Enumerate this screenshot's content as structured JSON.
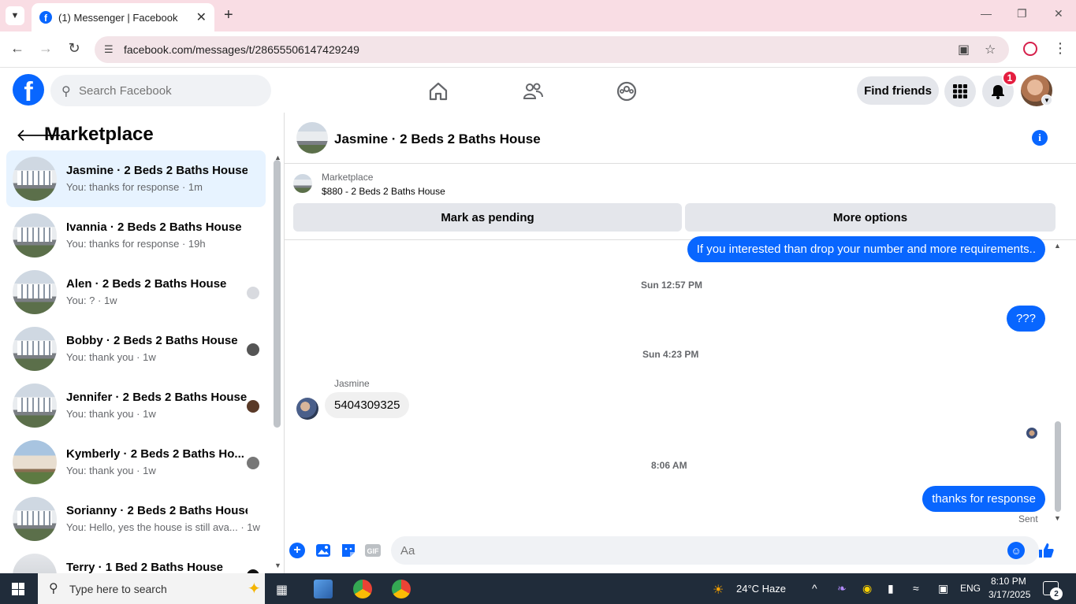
{
  "browser": {
    "tab_title": "(1) Messenger | Facebook",
    "url": "facebook.com/messages/t/28655506147429249"
  },
  "header": {
    "search_placeholder": "Search Facebook",
    "find_friends": "Find friends",
    "notification_count": "1"
  },
  "sidebar": {
    "title": "Marketplace",
    "conversations": [
      {
        "name": "Jasmine · 2 Beds 2 Baths House",
        "preview": "You: thanks for response · 1m",
        "active": true
      },
      {
        "name": "Ivannia · 2 Beds 2 Baths House",
        "preview": "You: thanks for response · 19h"
      },
      {
        "name": "Alen · 2 Beds 2 Baths House",
        "preview": "You: ? · 1w"
      },
      {
        "name": "Bobby · 2 Beds 2 Baths House",
        "preview": "You: thank you · 1w"
      },
      {
        "name": "Jennifer · 2 Beds 2 Baths House",
        "preview": "You: thank you · 1w"
      },
      {
        "name": "Kymberly · 2 Beds 2 Baths Ho...",
        "preview": "You: thank you · 1w"
      },
      {
        "name": "Sorianny · 2 Beds 2 Baths House",
        "preview": "You: Hello, yes the house is still ava... · 1w"
      },
      {
        "name": "Terry · 1 Bed 2 Baths House",
        "preview": ""
      }
    ]
  },
  "chat": {
    "title": "Jasmine · 2 Beds 2 Baths House",
    "marketplace_label": "Marketplace",
    "listing": "$880 - 2 Beds 2 Baths House",
    "mark_pending": "Mark as pending",
    "more_options": "More options",
    "messages": {
      "out1": "If you interested than drop your number and more requirements..",
      "ts1": "Sun 12:57 PM",
      "out2": "???",
      "ts2": "Sun 4:23 PM",
      "sender": "Jasmine",
      "in1": "5404309325",
      "ts3": "8:06 AM",
      "out3": "thanks for response",
      "status": "Sent"
    },
    "composer_placeholder": "Aa"
  },
  "taskbar": {
    "search_text": "Type here to search",
    "weather": "24°C  Haze",
    "lang": "ENG",
    "time": "8:10 PM",
    "date": "3/17/2025",
    "notif_count": "2"
  }
}
